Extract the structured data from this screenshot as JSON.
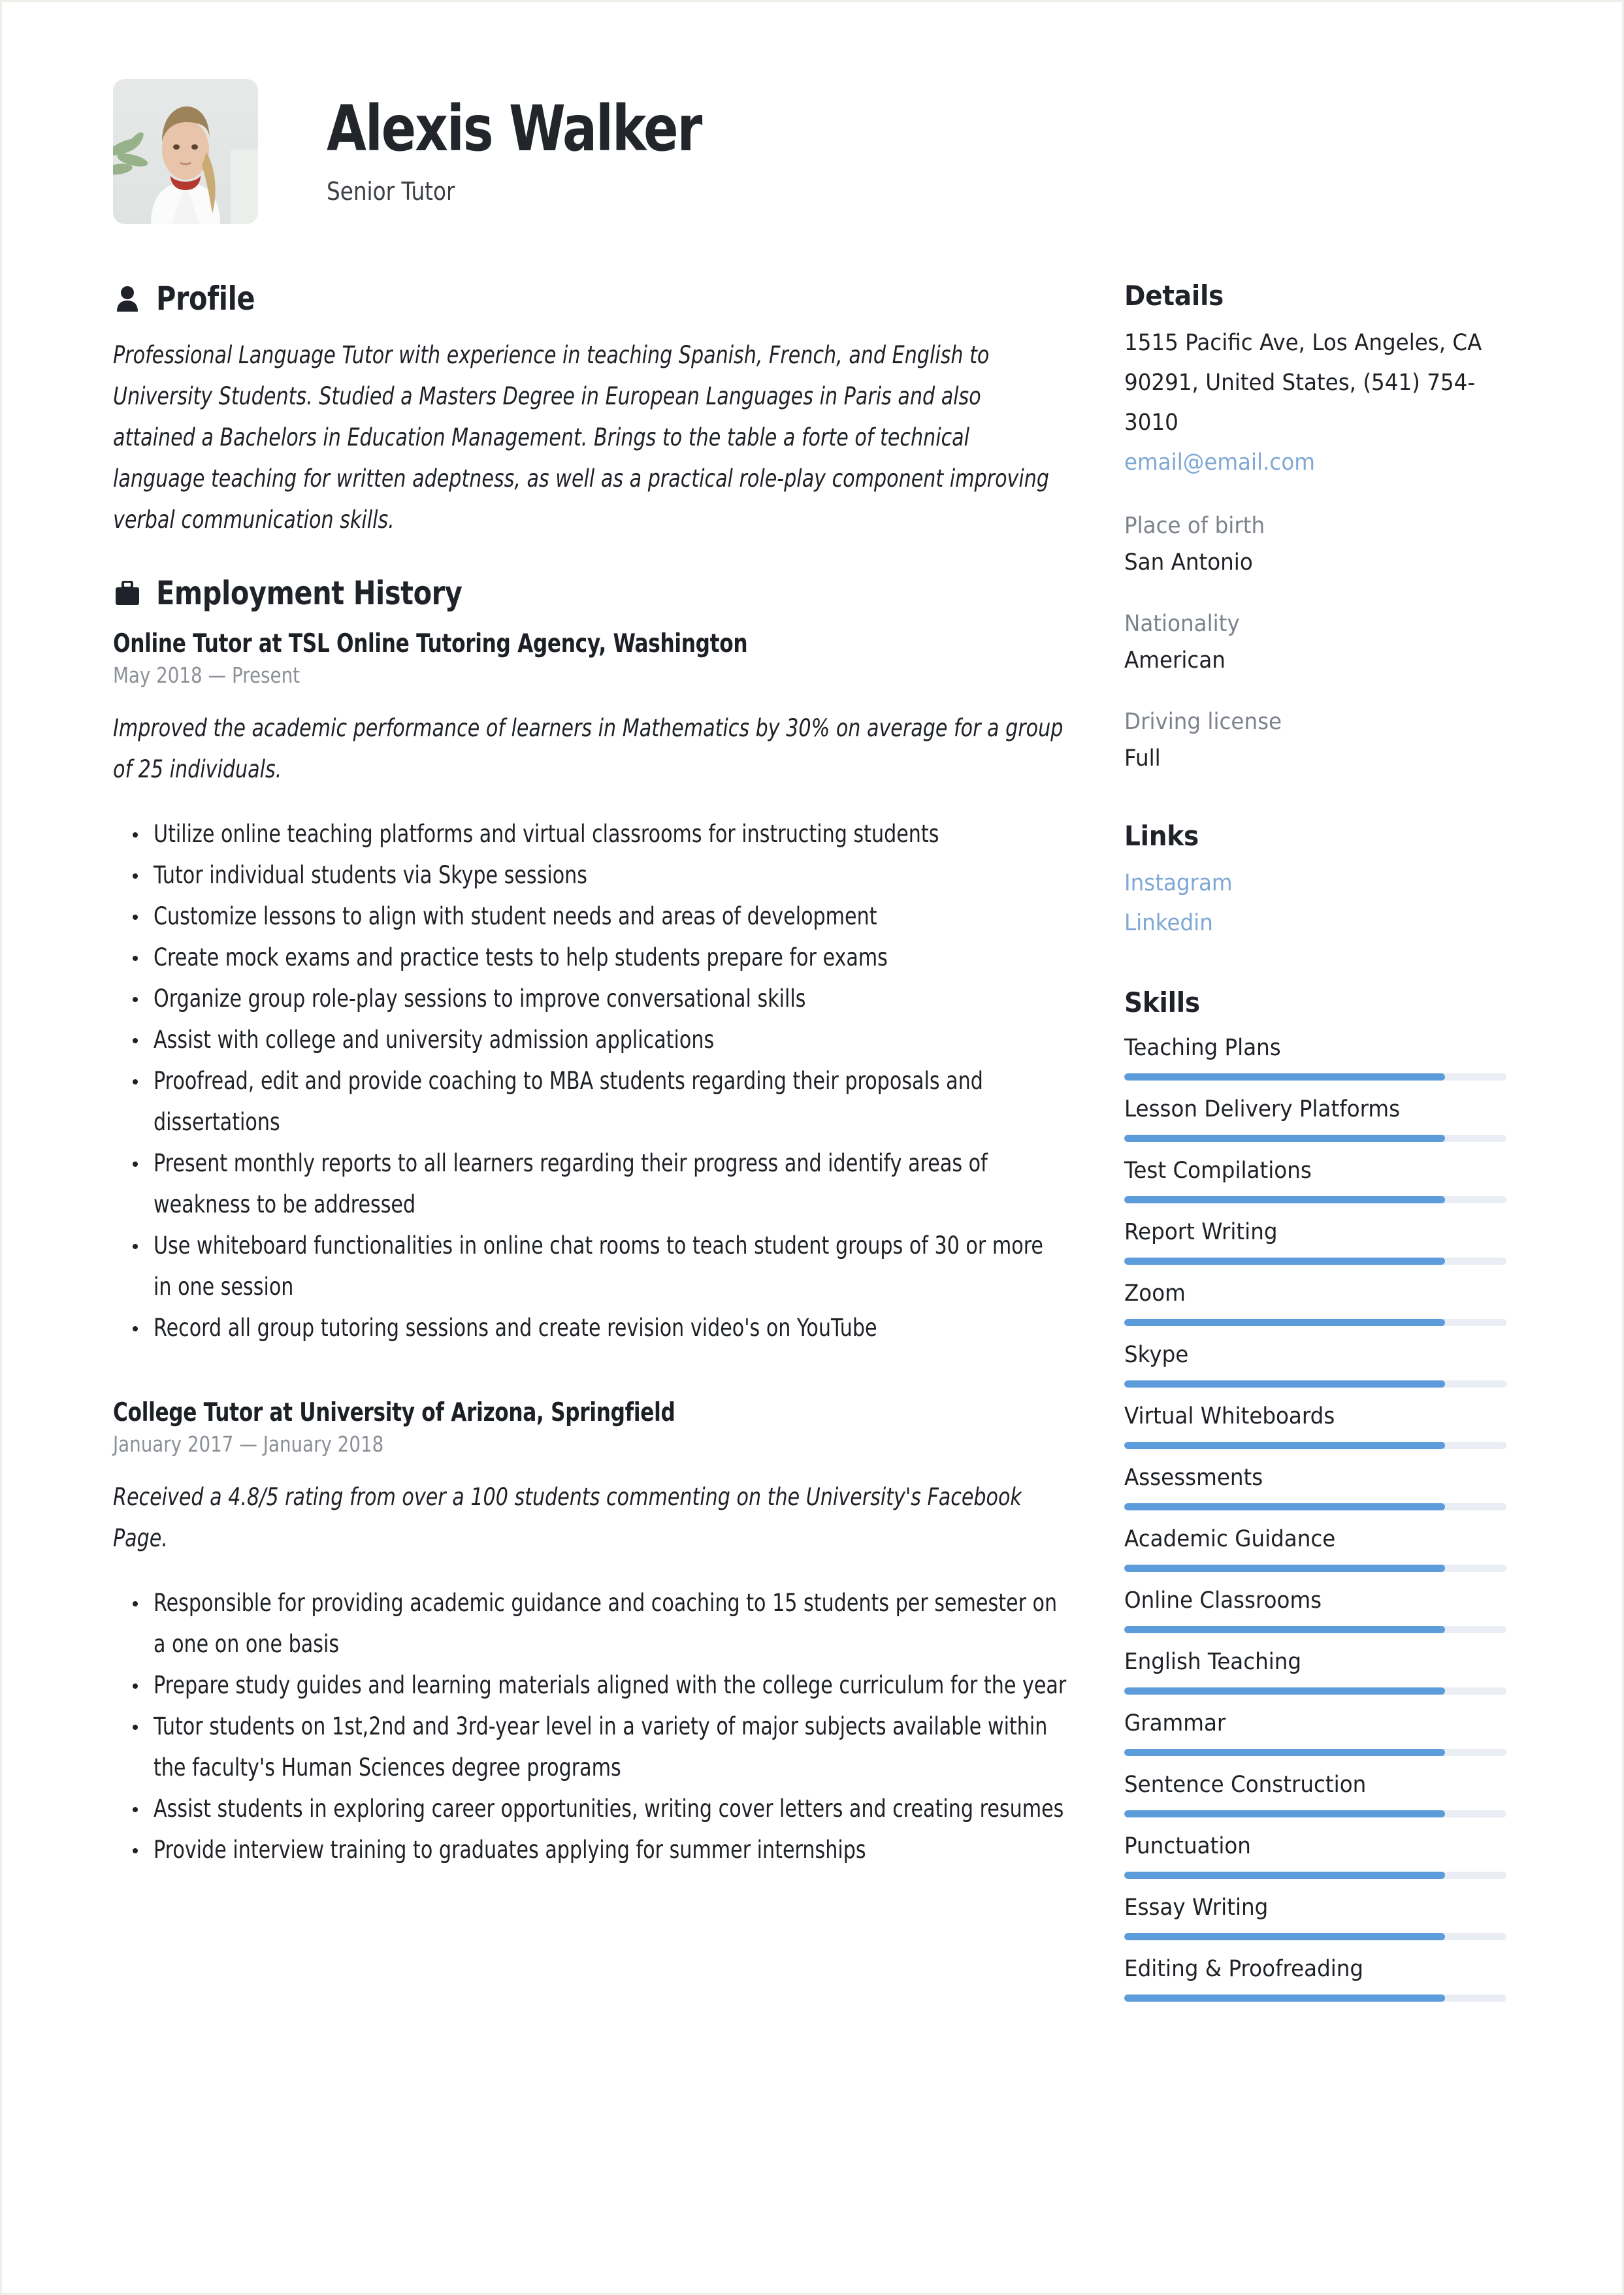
{
  "header": {
    "name": "Alexis Walker",
    "job_title": "Senior Tutor",
    "avatar_alt": "portrait-photo"
  },
  "profile": {
    "section_title": "Profile",
    "icon": "person-icon",
    "text": "Professional Language Tutor with experience in teaching Spanish, French, and English to University Students. Studied a Masters Degree in European Languages in Paris and also attained a Bachelors in Education Management. Brings to the table a forte of technical language teaching for written adeptness, as well as a practical role-play component improving verbal communication skills."
  },
  "employment": {
    "section_title": "Employment History",
    "icon": "briefcase-icon",
    "jobs": [
      {
        "heading": "Online Tutor at  TSL Online Tutoring Agency, Washington",
        "dates": "May 2018 — Present",
        "summary": "Improved the academic performance of learners in Mathematics by 30% on average for a group of 25 individuals.",
        "bullets": [
          "Utilize online teaching platforms and virtual classrooms for instructing students",
          "Tutor individual students via Skype sessions",
          "Customize lessons to align with student needs and areas of development",
          "Create mock exams and practice tests to help students prepare for exams",
          "Organize group role-play sessions to improve conversational skills",
          "Assist with college and university admission applications",
          "Proofread, edit and provide coaching to MBA students regarding their proposals and dissertations",
          "Present monthly reports to all learners regarding their progress and identify areas of weakness to be addressed",
          "Use whiteboard functionalities in online chat rooms to teach student groups of 30 or more in one session",
          "Record all group tutoring sessions and create revision video's on YouTube"
        ]
      },
      {
        "heading": "College Tutor at  University of Arizona, Springfield",
        "dates": "January 2017 — January 2018",
        "summary": "Received a 4.8/5 rating from over a 100 students commenting on the University's Facebook Page.",
        "bullets": [
          "Responsible for providing academic guidance and coaching to 15 students per semester on a one on one basis",
          "Prepare study guides and learning materials aligned with the college curriculum for the year",
          "Tutor students on 1st,2nd and 3rd-year level in a variety of major subjects available within the faculty's Human Sciences degree programs",
          "Assist students in exploring career opportunities, writing cover letters and creating resumes",
          "Provide interview training to graduates applying for summer internships"
        ]
      }
    ]
  },
  "details": {
    "heading": "Details",
    "address": "1515 Pacific Ave, Los Angeles, CA 90291, United States, (541) 754-3010",
    "email": "email@email.com",
    "fields": [
      {
        "label": "Place of birth",
        "value": "San Antonio"
      },
      {
        "label": "Nationality",
        "value": "American"
      },
      {
        "label": "Driving license",
        "value": "Full"
      }
    ]
  },
  "links": {
    "heading": "Links",
    "items": [
      {
        "label": "Instagram"
      },
      {
        "label": "Linkedin"
      }
    ]
  },
  "skills": {
    "heading": "Skills",
    "items": [
      {
        "name": "Teaching Plans",
        "level": 84
      },
      {
        "name": "Lesson Delivery Platforms",
        "level": 84
      },
      {
        "name": "Test Compilations",
        "level": 84
      },
      {
        "name": "Report Writing",
        "level": 84
      },
      {
        "name": "Zoom",
        "level": 84
      },
      {
        "name": "Skype",
        "level": 84
      },
      {
        "name": "Virtual Whiteboards",
        "level": 84
      },
      {
        "name": "Assessments",
        "level": 84
      },
      {
        "name": "Academic Guidance",
        "level": 84
      },
      {
        "name": "Online Classrooms",
        "level": 84
      },
      {
        "name": "English Teaching",
        "level": 84
      },
      {
        "name": "Grammar",
        "level": 84
      },
      {
        "name": "Sentence Construction",
        "level": 84
      },
      {
        "name": "Punctuation",
        "level": 84
      },
      {
        "name": "Essay Writing",
        "level": 84
      },
      {
        "name": "Editing & Proofreading",
        "level": 84
      }
    ]
  },
  "colors": {
    "accent": "#5d9cdb",
    "link": "#7fa8d4",
    "track": "#eaedf3",
    "text": "#1e2125",
    "muted": "#7d838b"
  }
}
